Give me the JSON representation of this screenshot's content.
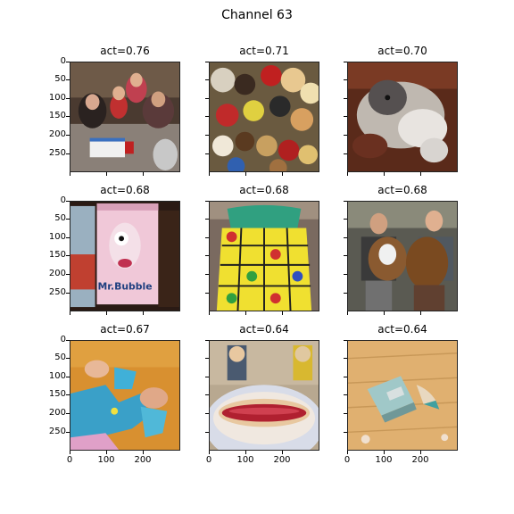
{
  "figure": {
    "title": "Channel 63"
  },
  "panels": [
    {
      "label": "act=0.76",
      "subject": "birthday party"
    },
    {
      "label": "act=0.71",
      "subject": "stuffed toys"
    },
    {
      "label": "act=0.70",
      "subject": "dog on couch"
    },
    {
      "label": "act=0.68",
      "subject": "Mr. Bubble tin"
    },
    {
      "label": "act=0.68",
      "subject": "fruit apron"
    },
    {
      "label": "act=0.68",
      "subject": "men with dogs"
    },
    {
      "label": "act=0.67",
      "subject": "jigsaw puzzle"
    },
    {
      "label": "act=0.64",
      "subject": "hot dog"
    },
    {
      "label": "act=0.64",
      "subject": "pencil sharpener"
    }
  ],
  "axes": {
    "y_ticks": [
      "0",
      "50",
      "100",
      "150",
      "200",
      "250"
    ],
    "x_ticks": [
      "0",
      "100",
      "200"
    ]
  },
  "image_text": {
    "mr_bubble": "Mr.Bubble"
  }
}
